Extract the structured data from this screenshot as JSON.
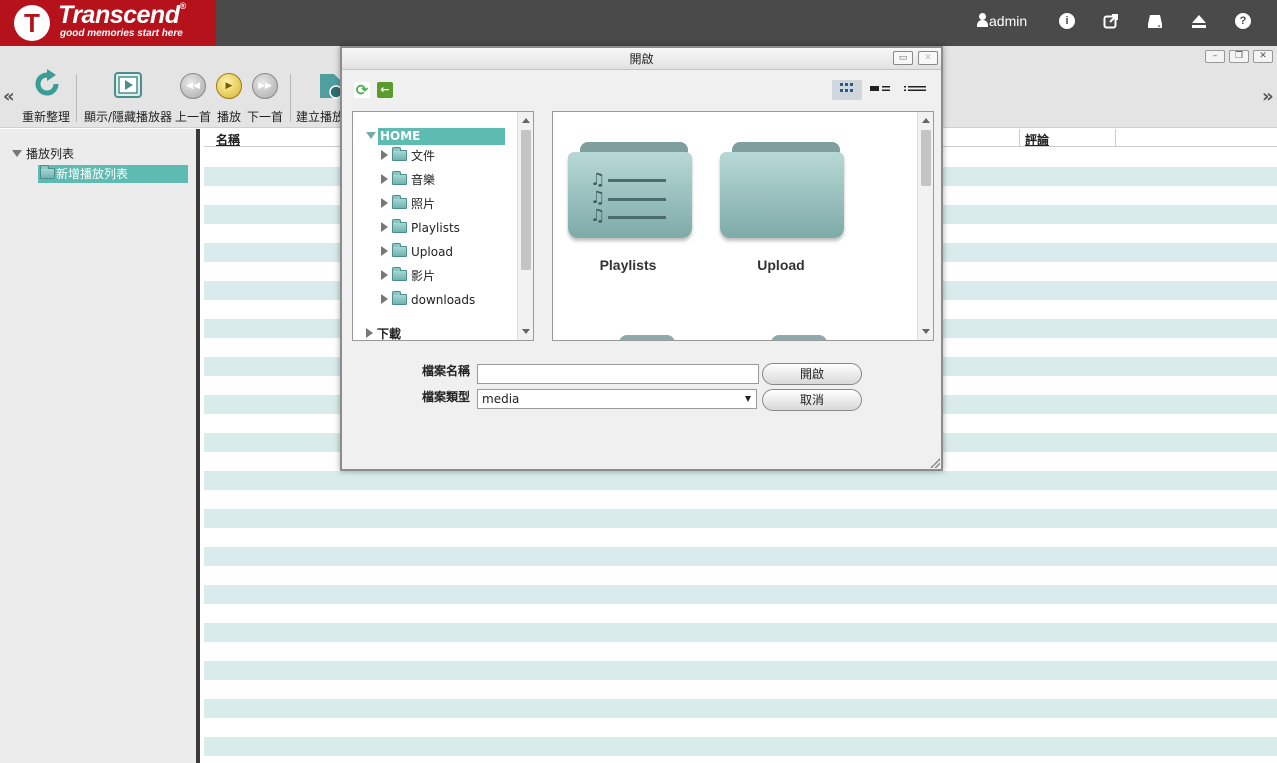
{
  "header": {
    "brand": "Transcend",
    "brand_reg": "®",
    "tagline": "good memories start here",
    "user": "admin",
    "icons": [
      "info-icon",
      "external-link-icon",
      "drive-icon",
      "eject-icon",
      "help-icon"
    ]
  },
  "toolbar": {
    "scroll_left": "«",
    "scroll_right": "»",
    "buttons": [
      {
        "label": "重新整理",
        "icon": "refresh-icon"
      },
      {
        "label": "顯示/隱藏播放器",
        "icon": "player-toggle-icon"
      },
      {
        "label": "上一首",
        "icon": "rewind-icon"
      },
      {
        "label": "播放",
        "icon": "play-icon"
      },
      {
        "label": "下一首",
        "icon": "forward-icon"
      },
      {
        "label": "建立播放",
        "icon": "create-playlist-icon"
      }
    ]
  },
  "sidebar": {
    "root": "播放列表",
    "selected_item": "新增播放列表"
  },
  "grid": {
    "col_name": "名稱",
    "col_comment": "評論"
  },
  "dialog": {
    "title": "開啟",
    "tree": {
      "root": "HOME",
      "items": [
        "文件",
        "音樂",
        "照片",
        "Playlists",
        "Upload",
        "影片",
        "downloads"
      ],
      "root2": "下載"
    },
    "files": [
      {
        "label": "Playlists",
        "icon": "playlist-folder-icon"
      },
      {
        "label": "Upload",
        "icon": "folder-icon"
      }
    ],
    "filename_label": "檔案名稱",
    "filename_value": "",
    "filetype_label": "檔案類型",
    "filetype_value": "media",
    "open_button": "開啟",
    "cancel_button": "取消"
  },
  "colors": {
    "brand_red": "#b5121b",
    "header_bg": "#4a4a4a",
    "accent_teal": "#5dbbb1",
    "stripe": "#d9ebeb"
  }
}
